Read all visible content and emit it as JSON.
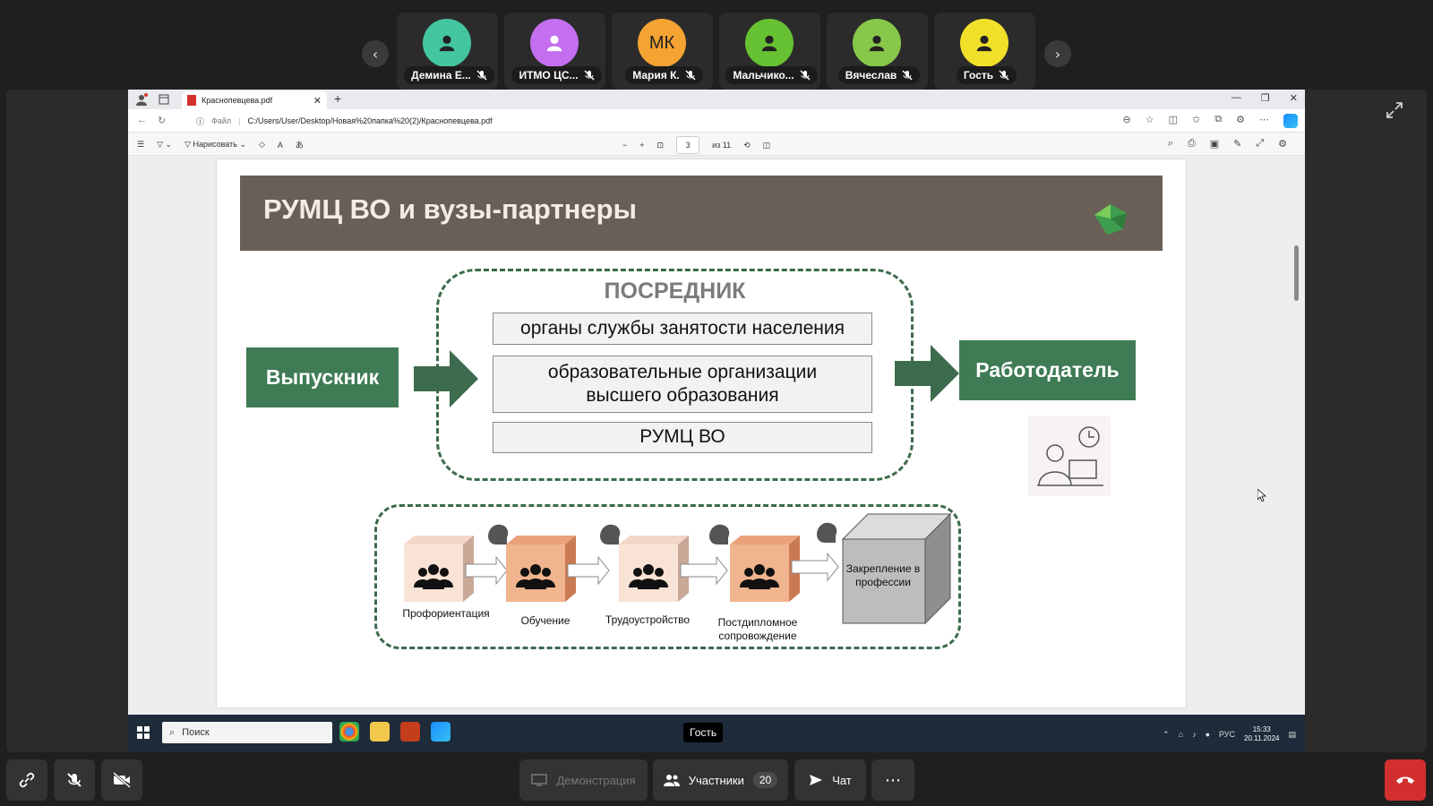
{
  "participants": [
    {
      "name": "Демина Е...",
      "initials": "",
      "color": "#43c6a0"
    },
    {
      "name": "ИТМО ЦС...",
      "initials": "",
      "color": "#c46ff0"
    },
    {
      "name": "Мария К.",
      "initials": "МК",
      "color": "#f5a332"
    },
    {
      "name": "Мальчико...",
      "initials": "",
      "color": "#66c232"
    },
    {
      "name": "Вячеслав",
      "initials": "",
      "color": "#87c84a"
    },
    {
      "name": "Гость",
      "initials": "",
      "color": "#f1e02a"
    }
  ],
  "browser": {
    "tab_title": "Краснопевцева.pdf",
    "address_label": "Файл",
    "url": "C:/Users/User/Desktop/Новая%20папка%20(2)/Краснопевцева.pdf",
    "draw_label": "Нарисовать",
    "page_current": "3",
    "page_total": "из 11"
  },
  "slide": {
    "title": "РУМЦ ВО и вузы-партнеры",
    "mediator_title": "ПОСРЕДНИК",
    "mediator_items": [
      "органы службы занятости населения",
      "образовательные организации высшего образования",
      "РУМЦ ВО"
    ],
    "graduate": "Выпускник",
    "employer": "Работодатель",
    "steps": [
      "Профориентация",
      "Обучение",
      "Трудоустройство",
      "Постдипломное сопровождение"
    ],
    "final_step": "Закрепление в профессии"
  },
  "taskbar": {
    "search": "Поиск",
    "presenter": "Гость",
    "lang": "РУС",
    "time": "15:33",
    "date": "20.11.2024"
  },
  "controls": {
    "share": "Демонстрация",
    "participants": "Участники",
    "participants_count": "20",
    "chat": "Чат"
  }
}
